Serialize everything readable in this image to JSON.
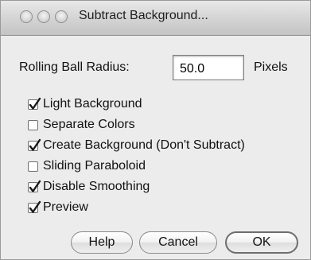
{
  "window": {
    "title": "Subtract Background..."
  },
  "radius": {
    "label": "Rolling Ball Radius:",
    "value": "50.0",
    "unit": "Pixels"
  },
  "options": [
    {
      "label": "Light Background",
      "checked": true
    },
    {
      "label": "Separate Colors",
      "checked": false
    },
    {
      "label": "Create Background (Don't Subtract)",
      "checked": true
    },
    {
      "label": "Sliding Paraboloid",
      "checked": false
    },
    {
      "label": "Disable Smoothing",
      "checked": true
    },
    {
      "label": "Preview",
      "checked": true
    }
  ],
  "buttons": {
    "help": "Help",
    "cancel": "Cancel",
    "ok": "OK"
  }
}
